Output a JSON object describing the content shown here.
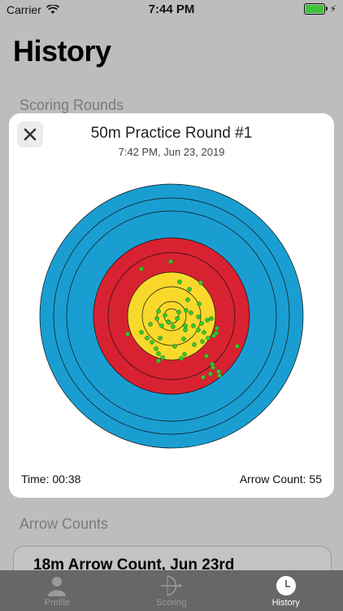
{
  "status": {
    "carrier": "Carrier",
    "time": "7:44 PM",
    "battery_level": 1.0,
    "battery_color": "#3cc53c"
  },
  "page": {
    "title": "History",
    "section_scoring": "Scoring Rounds",
    "section_arrow": "Arrow Counts",
    "arrow_card_title": "18m Arrow Count, Jun 23rd"
  },
  "modal": {
    "title": "50m Practice Round #1",
    "subtitle": "7:42 PM, Jun 23, 2019",
    "time_text": "Time: 00:38",
    "arrow_count_text": "Arrow Count: 55",
    "target_colors": {
      "blue": "#1a9ed2",
      "red": "#d92231",
      "yellow": "#f8d92b",
      "dot": "#39c52f"
    }
  },
  "tabs": [
    {
      "label": "Profile",
      "icon": "person-icon",
      "active": false
    },
    {
      "label": "Scoring",
      "icon": "bow-arrow-icon",
      "active": false
    },
    {
      "label": "History",
      "icon": "clock-icon",
      "active": true
    }
  ]
}
